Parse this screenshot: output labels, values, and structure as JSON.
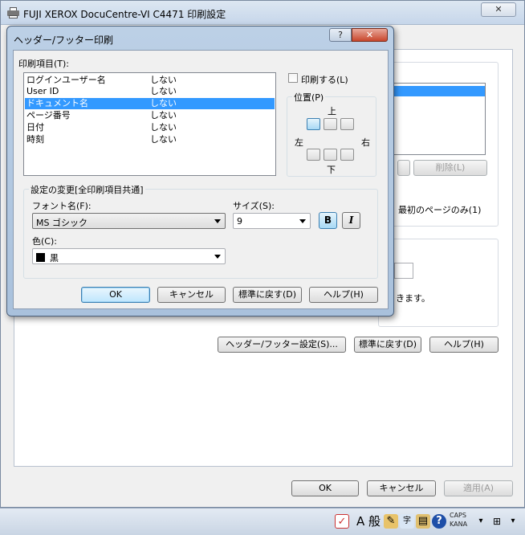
{
  "parent": {
    "title": "FUJI XEROX DocuCentre-VI C4471 印刷設定",
    "close_label": "✕",
    "delete_label": "削除(L)",
    "first_page_only_label": "最初のページのみ(1)",
    "partial_text": "きます。",
    "header_footer_settings_label": "ヘッダー/フッター設定(S)...",
    "reset_label": "標準に戻す(D)",
    "help_label": "ヘルプ(H)",
    "ok_label": "OK",
    "cancel_label": "キャンセル",
    "apply_label": "適用(A)"
  },
  "dialog": {
    "title": "ヘッダー/フッター印刷",
    "help_btn": "?",
    "close_btn": "✕",
    "print_items_label": "印刷項目(T):",
    "items": [
      {
        "name": "ログインユーザー名",
        "value": "しない"
      },
      {
        "name": "User ID",
        "value": "しない"
      },
      {
        "name": "ドキュメント名",
        "value": "しない"
      },
      {
        "name": "ページ番号",
        "value": "しない"
      },
      {
        "name": "日付",
        "value": "しない"
      },
      {
        "name": "時刻",
        "value": "しない"
      }
    ],
    "selected_index": 2,
    "print_checkbox_label": "印刷する(L)",
    "position_label": "位置(P)",
    "pos_top": "上",
    "pos_left": "左",
    "pos_right": "右",
    "pos_bottom": "下",
    "common_label": "設定の変更[全印刷項目共通]",
    "font_name_label": "フォント名(F):",
    "font_value": "MS ゴシック",
    "size_label": "サイズ(S):",
    "size_value": "9",
    "bold_label": "B",
    "italic_label": "I",
    "color_label": "色(C):",
    "color_value": "黒",
    "ok_label": "OK",
    "cancel_label": "キャンセル",
    "reset_label": "標準に戻す(D)",
    "help_label": "ヘルプ(H)"
  },
  "taskbar": {
    "ime_label": "A 般",
    "caps_label": "CAPS",
    "kana_label": "KANA"
  },
  "colors": {
    "selection": "#3399ff",
    "close_red": "#c8462c",
    "desktop": "#6b86a8"
  }
}
